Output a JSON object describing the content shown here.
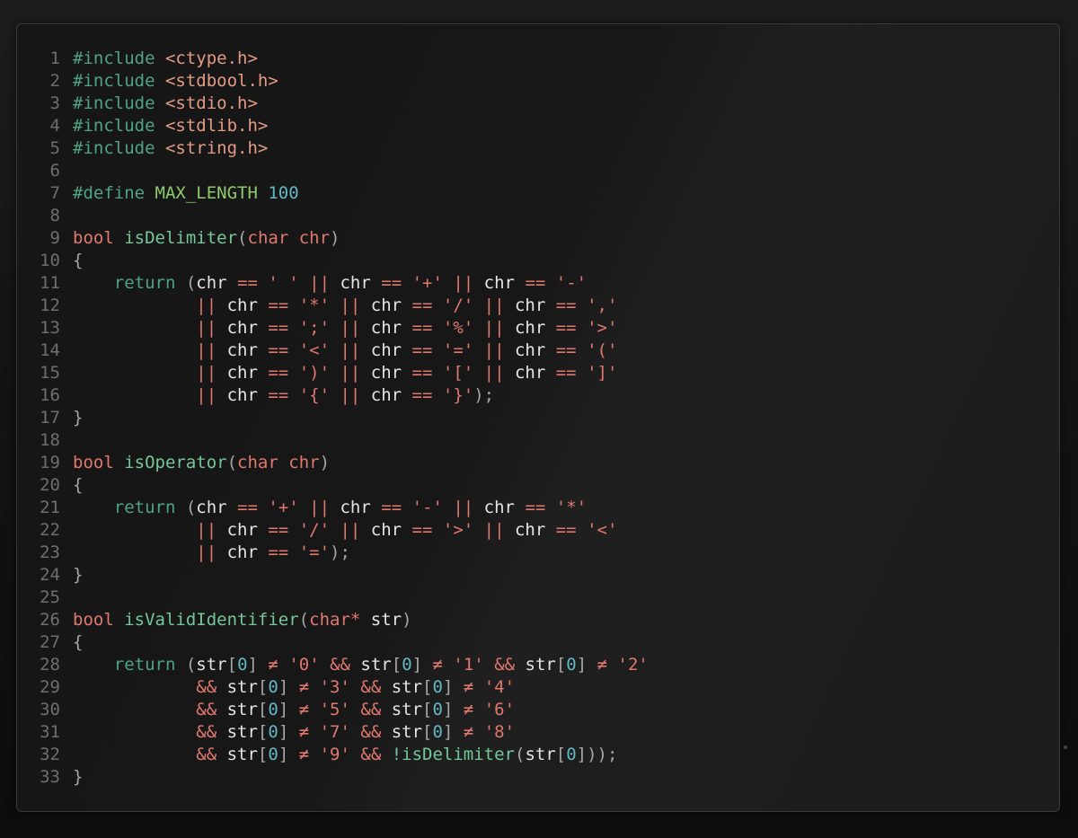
{
  "editor": {
    "lines": [
      {
        "n": "1",
        "t": [
          [
            "pp",
            "#include "
          ],
          [
            "inc",
            "<ctype.h>"
          ]
        ]
      },
      {
        "n": "2",
        "t": [
          [
            "pp",
            "#include "
          ],
          [
            "inc",
            "<stdbool.h>"
          ]
        ]
      },
      {
        "n": "3",
        "t": [
          [
            "pp",
            "#include "
          ],
          [
            "inc",
            "<stdio.h>"
          ]
        ]
      },
      {
        "n": "4",
        "t": [
          [
            "pp",
            "#include "
          ],
          [
            "inc",
            "<stdlib.h>"
          ]
        ]
      },
      {
        "n": "5",
        "t": [
          [
            "pp",
            "#include "
          ],
          [
            "inc",
            "<string.h>"
          ]
        ]
      },
      {
        "n": "6",
        "t": []
      },
      {
        "n": "7",
        "t": [
          [
            "pp",
            "#define "
          ],
          [
            "mac",
            "MAX_LENGTH "
          ],
          [
            "num",
            "100"
          ]
        ]
      },
      {
        "n": "8",
        "t": []
      },
      {
        "n": "9",
        "t": [
          [
            "ty",
            "bool "
          ],
          [
            "fn",
            "isDelimiter"
          ],
          [
            "pn",
            "("
          ],
          [
            "ty",
            "char "
          ],
          [
            "kw",
            "chr"
          ],
          [
            "pn",
            ")"
          ]
        ]
      },
      {
        "n": "10",
        "t": [
          [
            "pn",
            "{"
          ]
        ]
      },
      {
        "n": "11",
        "t": [
          [
            "ret",
            "    return "
          ],
          [
            "pn",
            "("
          ],
          [
            "id",
            "chr "
          ],
          [
            "op",
            "== "
          ],
          [
            "str",
            "' ' "
          ],
          [
            "op",
            "|| "
          ],
          [
            "id",
            "chr "
          ],
          [
            "op",
            "== "
          ],
          [
            "str",
            "'+' "
          ],
          [
            "op",
            "|| "
          ],
          [
            "id",
            "chr "
          ],
          [
            "op",
            "== "
          ],
          [
            "str",
            "'-'"
          ]
        ]
      },
      {
        "n": "12",
        "t": [
          [
            "op",
            "            || "
          ],
          [
            "id",
            "chr "
          ],
          [
            "op",
            "== "
          ],
          [
            "str",
            "'*' "
          ],
          [
            "op",
            "|| "
          ],
          [
            "id",
            "chr "
          ],
          [
            "op",
            "== "
          ],
          [
            "str",
            "'/' "
          ],
          [
            "op",
            "|| "
          ],
          [
            "id",
            "chr "
          ],
          [
            "op",
            "== "
          ],
          [
            "str",
            "','"
          ]
        ]
      },
      {
        "n": "13",
        "t": [
          [
            "op",
            "            || "
          ],
          [
            "id",
            "chr "
          ],
          [
            "op",
            "== "
          ],
          [
            "str",
            "';' "
          ],
          [
            "op",
            "|| "
          ],
          [
            "id",
            "chr "
          ],
          [
            "op",
            "== "
          ],
          [
            "str",
            "'%' "
          ],
          [
            "op",
            "|| "
          ],
          [
            "id",
            "chr "
          ],
          [
            "op",
            "== "
          ],
          [
            "str",
            "'>'"
          ]
        ]
      },
      {
        "n": "14",
        "t": [
          [
            "op",
            "            || "
          ],
          [
            "id",
            "chr "
          ],
          [
            "op",
            "== "
          ],
          [
            "str",
            "'<' "
          ],
          [
            "op",
            "|| "
          ],
          [
            "id",
            "chr "
          ],
          [
            "op",
            "== "
          ],
          [
            "str",
            "'=' "
          ],
          [
            "op",
            "|| "
          ],
          [
            "id",
            "chr "
          ],
          [
            "op",
            "== "
          ],
          [
            "str",
            "'('"
          ]
        ]
      },
      {
        "n": "15",
        "t": [
          [
            "op",
            "            || "
          ],
          [
            "id",
            "chr "
          ],
          [
            "op",
            "== "
          ],
          [
            "str",
            "')' "
          ],
          [
            "op",
            "|| "
          ],
          [
            "id",
            "chr "
          ],
          [
            "op",
            "== "
          ],
          [
            "str",
            "'[' "
          ],
          [
            "op",
            "|| "
          ],
          [
            "id",
            "chr "
          ],
          [
            "op",
            "== "
          ],
          [
            "str",
            "']'"
          ]
        ]
      },
      {
        "n": "16",
        "t": [
          [
            "op",
            "            || "
          ],
          [
            "id",
            "chr "
          ],
          [
            "op",
            "== "
          ],
          [
            "str",
            "'{' "
          ],
          [
            "op",
            "|| "
          ],
          [
            "id",
            "chr "
          ],
          [
            "op",
            "== "
          ],
          [
            "str",
            "'}'"
          ],
          [
            "pn",
            ");"
          ]
        ]
      },
      {
        "n": "17",
        "t": [
          [
            "pn",
            "}"
          ]
        ]
      },
      {
        "n": "18",
        "t": []
      },
      {
        "n": "19",
        "t": [
          [
            "ty",
            "bool "
          ],
          [
            "fn",
            "isOperator"
          ],
          [
            "pn",
            "("
          ],
          [
            "ty",
            "char "
          ],
          [
            "kw",
            "chr"
          ],
          [
            "pn",
            ")"
          ]
        ]
      },
      {
        "n": "20",
        "t": [
          [
            "pn",
            "{"
          ]
        ]
      },
      {
        "n": "21",
        "t": [
          [
            "ret",
            "    return "
          ],
          [
            "pn",
            "("
          ],
          [
            "id",
            "chr "
          ],
          [
            "op",
            "== "
          ],
          [
            "str",
            "'+' "
          ],
          [
            "op",
            "|| "
          ],
          [
            "id",
            "chr "
          ],
          [
            "op",
            "== "
          ],
          [
            "str",
            "'-' "
          ],
          [
            "op",
            "|| "
          ],
          [
            "id",
            "chr "
          ],
          [
            "op",
            "== "
          ],
          [
            "str",
            "'*'"
          ]
        ]
      },
      {
        "n": "22",
        "t": [
          [
            "op",
            "            || "
          ],
          [
            "id",
            "chr "
          ],
          [
            "op",
            "== "
          ],
          [
            "str",
            "'/' "
          ],
          [
            "op",
            "|| "
          ],
          [
            "id",
            "chr "
          ],
          [
            "op",
            "== "
          ],
          [
            "str",
            "'>' "
          ],
          [
            "op",
            "|| "
          ],
          [
            "id",
            "chr "
          ],
          [
            "op",
            "== "
          ],
          [
            "str",
            "'<'"
          ]
        ]
      },
      {
        "n": "23",
        "t": [
          [
            "op",
            "            || "
          ],
          [
            "id",
            "chr "
          ],
          [
            "op",
            "== "
          ],
          [
            "str",
            "'='"
          ],
          [
            "pn",
            ");"
          ]
        ]
      },
      {
        "n": "24",
        "t": [
          [
            "pn",
            "}"
          ]
        ]
      },
      {
        "n": "25",
        "t": []
      },
      {
        "n": "26",
        "t": [
          [
            "ty",
            "bool "
          ],
          [
            "fn",
            "isValidIdentifier"
          ],
          [
            "pn",
            "("
          ],
          [
            "ty",
            "char* "
          ],
          [
            "id",
            "str"
          ],
          [
            "pn",
            ")"
          ]
        ]
      },
      {
        "n": "27",
        "t": [
          [
            "pn",
            "{"
          ]
        ]
      },
      {
        "n": "28",
        "t": [
          [
            "ret",
            "    return "
          ],
          [
            "pn",
            "("
          ],
          [
            "id",
            "str"
          ],
          [
            "pn",
            "["
          ],
          [
            "idx",
            "0"
          ],
          [
            "pn",
            "] "
          ],
          [
            "op",
            "≠ "
          ],
          [
            "str",
            "'0' "
          ],
          [
            "op",
            "&& "
          ],
          [
            "id",
            "str"
          ],
          [
            "pn",
            "["
          ],
          [
            "idx",
            "0"
          ],
          [
            "pn",
            "] "
          ],
          [
            "op",
            "≠ "
          ],
          [
            "str",
            "'1' "
          ],
          [
            "op",
            "&& "
          ],
          [
            "id",
            "str"
          ],
          [
            "pn",
            "["
          ],
          [
            "idx",
            "0"
          ],
          [
            "pn",
            "] "
          ],
          [
            "op",
            "≠ "
          ],
          [
            "str",
            "'2'"
          ]
        ]
      },
      {
        "n": "29",
        "t": [
          [
            "op",
            "            && "
          ],
          [
            "id",
            "str"
          ],
          [
            "pn",
            "["
          ],
          [
            "idx",
            "0"
          ],
          [
            "pn",
            "] "
          ],
          [
            "op",
            "≠ "
          ],
          [
            "str",
            "'3' "
          ],
          [
            "op",
            "&& "
          ],
          [
            "id",
            "str"
          ],
          [
            "pn",
            "["
          ],
          [
            "idx",
            "0"
          ],
          [
            "pn",
            "] "
          ],
          [
            "op",
            "≠ "
          ],
          [
            "str",
            "'4'"
          ]
        ]
      },
      {
        "n": "30",
        "t": [
          [
            "op",
            "            && "
          ],
          [
            "id",
            "str"
          ],
          [
            "pn",
            "["
          ],
          [
            "idx",
            "0"
          ],
          [
            "pn",
            "] "
          ],
          [
            "op",
            "≠ "
          ],
          [
            "str",
            "'5' "
          ],
          [
            "op",
            "&& "
          ],
          [
            "id",
            "str"
          ],
          [
            "pn",
            "["
          ],
          [
            "idx",
            "0"
          ],
          [
            "pn",
            "] "
          ],
          [
            "op",
            "≠ "
          ],
          [
            "str",
            "'6'"
          ]
        ]
      },
      {
        "n": "31",
        "t": [
          [
            "op",
            "            && "
          ],
          [
            "id",
            "str"
          ],
          [
            "pn",
            "["
          ],
          [
            "idx",
            "0"
          ],
          [
            "pn",
            "] "
          ],
          [
            "op",
            "≠ "
          ],
          [
            "str",
            "'7' "
          ],
          [
            "op",
            "&& "
          ],
          [
            "id",
            "str"
          ],
          [
            "pn",
            "["
          ],
          [
            "idx",
            "0"
          ],
          [
            "pn",
            "] "
          ],
          [
            "op",
            "≠ "
          ],
          [
            "str",
            "'8'"
          ]
        ]
      },
      {
        "n": "32",
        "t": [
          [
            "op",
            "            && "
          ],
          [
            "id",
            "str"
          ],
          [
            "pn",
            "["
          ],
          [
            "idx",
            "0"
          ],
          [
            "pn",
            "] "
          ],
          [
            "op",
            "≠ "
          ],
          [
            "str",
            "'9' "
          ],
          [
            "op",
            "&& "
          ],
          [
            "fn",
            "!isDelimiter"
          ],
          [
            "pn",
            "("
          ],
          [
            "id",
            "str"
          ],
          [
            "pn",
            "["
          ],
          [
            "idx",
            "0"
          ],
          [
            "pn",
            "]));"
          ]
        ]
      },
      {
        "n": "33",
        "t": [
          [
            "pn",
            "}"
          ]
        ]
      }
    ]
  }
}
